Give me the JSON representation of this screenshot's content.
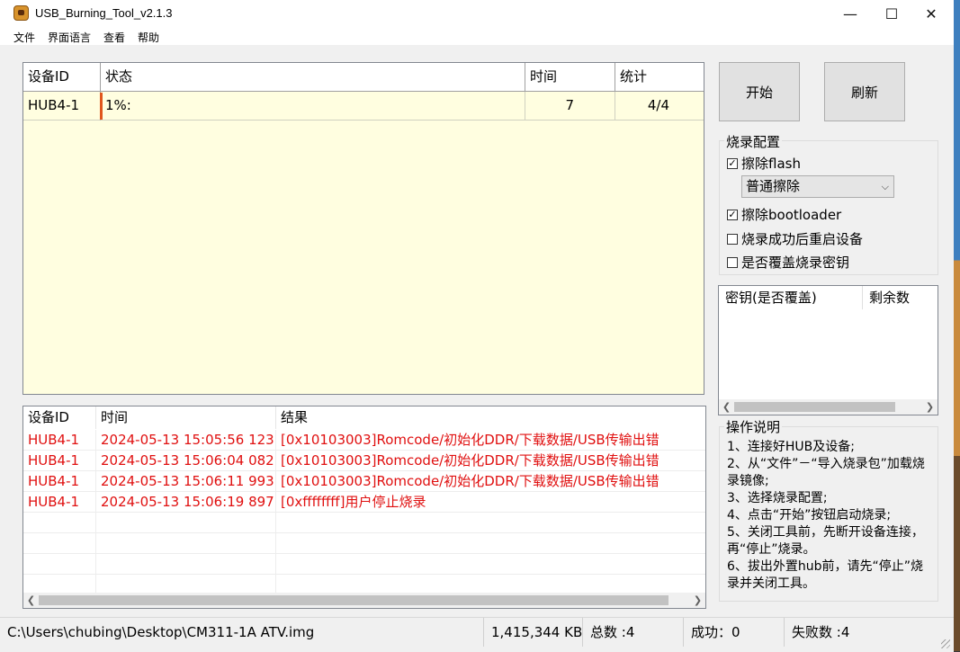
{
  "window": {
    "title": "USB_Burning_Tool_v2.1.3",
    "minimize_glyph": "—",
    "maximize_glyph": "☐",
    "close_glyph": "✕"
  },
  "menu": [
    "文件",
    "界面语言",
    "查看",
    "帮助"
  ],
  "device_table": {
    "headers": [
      "设备ID",
      "状态",
      "时间",
      "统计"
    ],
    "rows": [
      {
        "device_id": "HUB4-1",
        "status": "1%:",
        "time": "7",
        "stats": "4/4",
        "progress_pct": 1
      }
    ]
  },
  "log_table": {
    "headers": [
      "设备ID",
      "时间",
      "结果"
    ],
    "rows": [
      {
        "device_id": "HUB4-1",
        "time": "2024-05-13 15:05:56 123",
        "result": "[0x10103003]Romcode/初始化DDR/下载数据/USB传输出错"
      },
      {
        "device_id": "HUB4-1",
        "time": "2024-05-13 15:06:04 082",
        "result": "[0x10103003]Romcode/初始化DDR/下载数据/USB传输出错"
      },
      {
        "device_id": "HUB4-1",
        "time": "2024-05-13 15:06:11 993",
        "result": "[0x10103003]Romcode/初始化DDR/下载数据/USB传输出错"
      },
      {
        "device_id": "HUB4-1",
        "time": "2024-05-13 15:06:19 897",
        "result": "[0xffffffff]用户停止烧录"
      }
    ],
    "result_color": "#e01010"
  },
  "buttons": {
    "start": "开始",
    "refresh": "刷新"
  },
  "burn_config": {
    "title": "烧录配置",
    "erase_flash": {
      "label": "擦除flash",
      "checked": true
    },
    "erase_mode": "普通擦除",
    "erase_bootloader": {
      "label": "擦除bootloader",
      "checked": true
    },
    "reboot_after": {
      "label": "烧录成功后重启设备",
      "checked": false
    },
    "overwrite_key": {
      "label": "是否覆盖烧录密钥",
      "checked": false
    }
  },
  "key_table": {
    "headers": [
      "密钥(是否覆盖)",
      "剩余数"
    ]
  },
  "instructions": {
    "title": "操作说明",
    "lines": [
      "1、连接好HUB及设备;",
      "2、从“文件”－“导入烧录包”加载烧录镜像;",
      "3、选择烧录配置;",
      "4、点击“开始”按钮启动烧录;",
      "5、关闭工具前，先断开设备连接，再“停止”烧录。",
      "6、拔出外置hub前，请先“停止”烧录并关闭工具。"
    ]
  },
  "status_bar": {
    "path": "C:\\Users\\chubing\\Desktop\\CM311-1A ATV.img",
    "size": "1,415,344 KB",
    "total": "总数 :4",
    "success": "成功：0",
    "fail": "失败数 :4"
  },
  "icons": [
    "app-icon",
    "check-icon",
    "chevron-down-icon",
    "scroll-left-icon",
    "scroll-right-icon",
    "size-grip-icon"
  ]
}
